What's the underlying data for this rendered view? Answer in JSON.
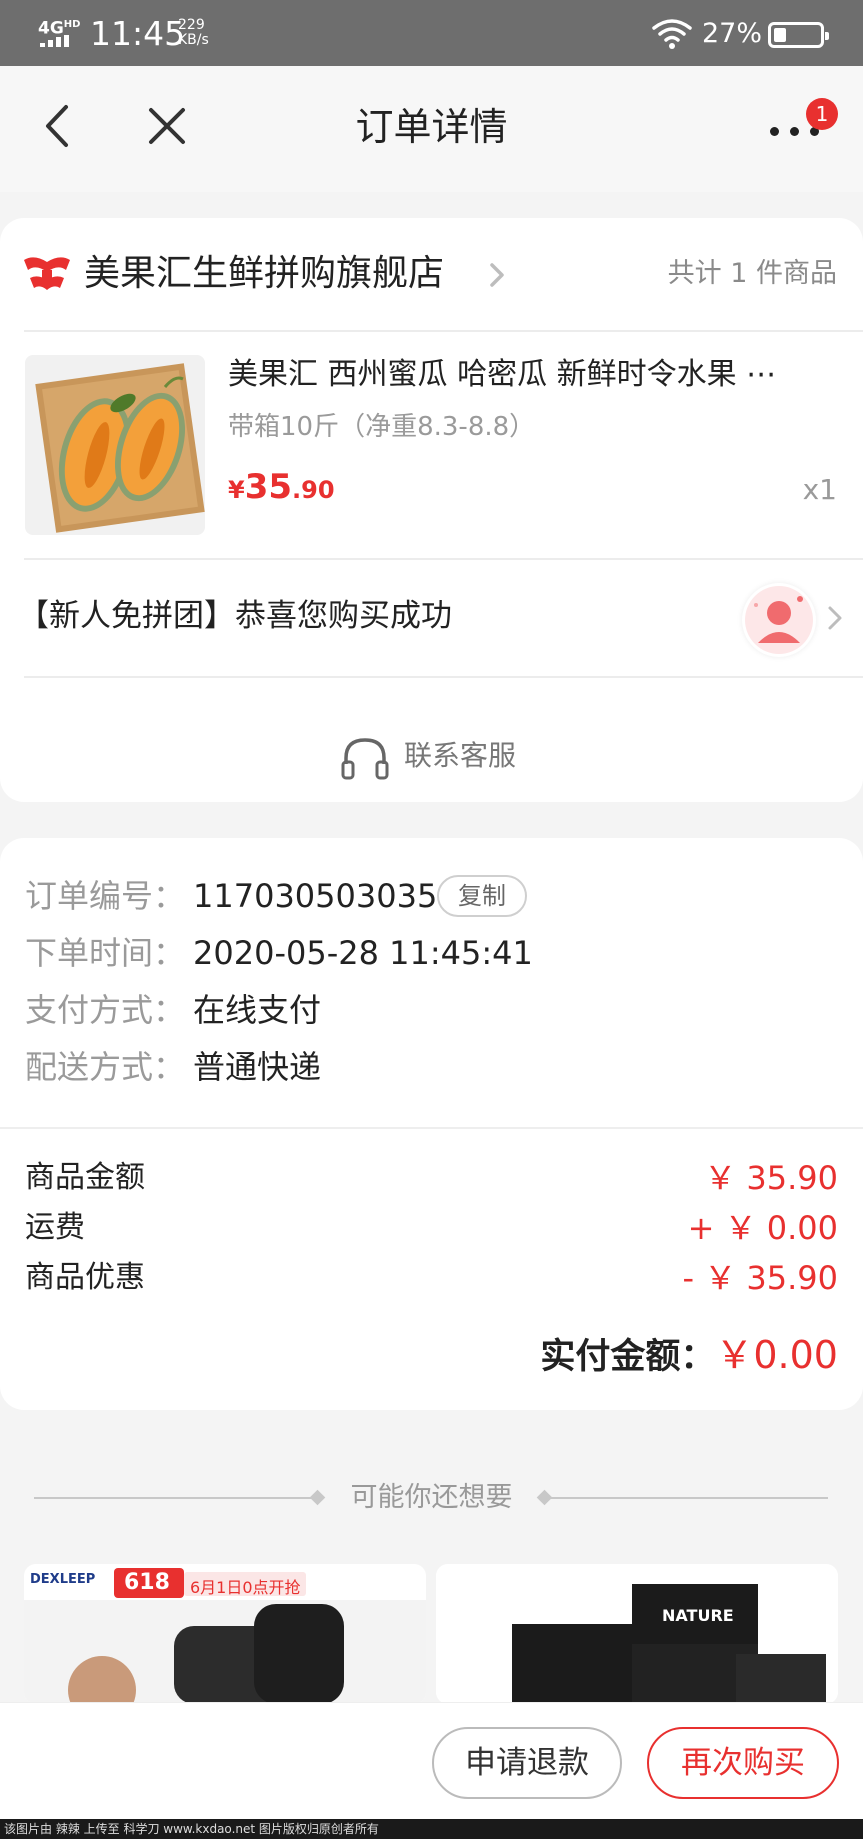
{
  "status_bar": {
    "network": "4G",
    "network_sup": "HD",
    "time": "11:45",
    "speed_value": "229",
    "speed_unit": "KB/s",
    "battery_percent": "27%",
    "battery_level": 0.27
  },
  "nav": {
    "title": "订单详情",
    "more_badge": "1"
  },
  "store": {
    "name": "美果汇生鲜拼购旗舰店",
    "count_text": "共计 1 件商品",
    "logo_color": "#e8302f"
  },
  "product": {
    "title": "美果汇 西州蜜瓜 哈密瓜 新鲜时令水果 ⋯",
    "spec": "带箱10斤（净重8.3-8.8）",
    "price_symbol": "¥",
    "price_int": "35",
    "price_dec": ".90",
    "qty": "x1"
  },
  "promo": {
    "text": "【新人免拼团】恭喜您购买成功"
  },
  "service": {
    "label": "联系客服"
  },
  "order_info": [
    {
      "label": "订单编号：",
      "value": "117030503035"
    },
    {
      "label": "下单时间：",
      "value": "2020-05-28 11:45:41"
    },
    {
      "label": "支付方式：",
      "value": "在线支付"
    },
    {
      "label": "配送方式：",
      "value": "普通快递"
    }
  ],
  "copy_label": "复制",
  "amounts": [
    {
      "label": "商品金额",
      "value": "￥ 35.90"
    },
    {
      "label": "运费",
      "value": "+ ￥ 0.00"
    },
    {
      "label": "商品优惠",
      "value": "- ￥ 35.90"
    }
  ],
  "total": {
    "label": "实付金额：",
    "value": "￥0.00"
  },
  "recommend": {
    "title": "可能你还想要",
    "items": [
      {
        "brand": "DEXLEEP",
        "promo_tag": "618",
        "promo_text": "6月1日0点开抢"
      },
      {
        "brand": "NATURE"
      }
    ]
  },
  "actions": {
    "refund": "申请退款",
    "rebuy": "再次购买"
  },
  "footer": "该图片由 辣辣 上传至 科学刀 www.kxdao.net 图片版权归原创者所有",
  "colors": {
    "accent": "#e8302f",
    "muted": "#9a9a9a",
    "status_bar": "#6e6e6e"
  }
}
